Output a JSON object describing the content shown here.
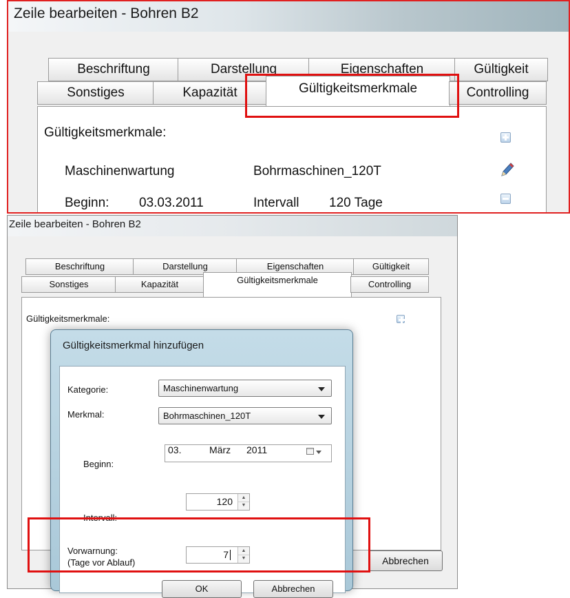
{
  "top": {
    "title": "Zeile  bearbeiten - Bohren B2",
    "tabs_row1": [
      "Beschriftung",
      "Darstellung",
      "Eigenschaften",
      "Gültigkeit"
    ],
    "tabs_row2": [
      "Sonstiges",
      "Kapazität",
      "Gültigkeitsmerkmale",
      "Controlling"
    ],
    "section_label": "Gültigkeitsmerkmale:",
    "entry": {
      "category": "Maschinenwartung",
      "feature": "Bohrmaschinen_120T",
      "begin_label": "Beginn:",
      "begin_value": "03.03.2011",
      "interval_label": "Intervall",
      "interval_value": "120 Tage"
    }
  },
  "bottom": {
    "title": "Zeile  bearbeiten - Bohren B2",
    "tabs_row1": [
      "Beschriftung",
      "Darstellung",
      "Eigenschaften",
      "Gültigkeit"
    ],
    "tabs_row2": [
      "Sonstiges",
      "Kapazität",
      "Gültigkeitsmerkmale",
      "Controlling"
    ],
    "section_label": "Gültigkeitsmerkmale:",
    "cancel_label": "Abbrechen"
  },
  "dialog": {
    "title": "Gültigkeitsmerkmal hinzufügen",
    "kategorie_label": "Kategorie:",
    "kategorie_value": "Maschinenwartung",
    "merkmal_label": "Merkmal:",
    "merkmal_value": "Bohrmaschinen_120T",
    "beginn_label": "Beginn:",
    "beginn_day": "03.",
    "beginn_month": "März",
    "beginn_year": "2011",
    "intervall_label": "Intervall:",
    "intervall_value": "120",
    "vorwarnung_label": "Vorwarnung:",
    "vorwarnung_sublabel": "(Tage vor Ablauf)",
    "vorwarnung_value": "7",
    "ok_label": "OK",
    "cancel_label": "Abbrechen"
  },
  "icons": [
    "plus-icon",
    "edit-pencil-icon",
    "minus-icon",
    "calendar-icon",
    "chevron-down-icon",
    "spin-up-icon",
    "spin-down-icon"
  ],
  "colors": {
    "highlight": "#e01010",
    "dialog_frame": "#a9c8d8"
  }
}
